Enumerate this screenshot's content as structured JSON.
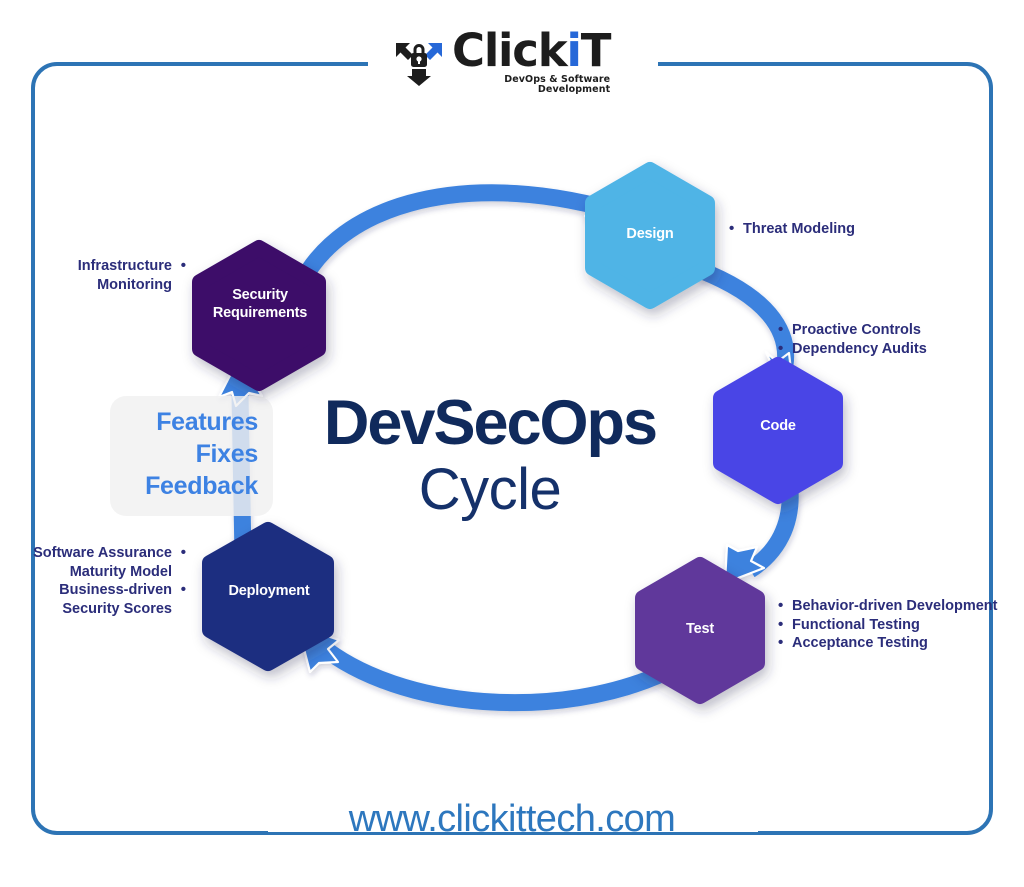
{
  "brand": {
    "logo_word_1": "Click",
    "logo_word_k": "i",
    "logo_word_2": "T",
    "logo_tagline": "DevOps & Software Development",
    "logo_icon": "shield-lock-arrows-icon"
  },
  "title": {
    "main": "DevSecOps",
    "sub": "Cycle"
  },
  "feature_box": {
    "line1": "Features",
    "line2": "Fixes",
    "line3": "Feedback"
  },
  "stages": [
    {
      "id": "security",
      "label": "Security\nRequirements",
      "color": "#3C1069"
    },
    {
      "id": "design",
      "label": "Design",
      "color": "#4FB4E6"
    },
    {
      "id": "code",
      "label": "Code",
      "color": "#4A45E6"
    },
    {
      "id": "test",
      "label": "Test",
      "color": "#60399B"
    },
    {
      "id": "deployment",
      "label": "Deployment",
      "color": "#1E2E80"
    }
  ],
  "stage_labels": {
    "security_line1": "Security",
    "security_line2": "Requirements",
    "design": "Design",
    "code": "Code",
    "test": "Test",
    "deployment": "Deployment"
  },
  "annotations": {
    "infrastructure": [
      "Infrastructure Monitoring"
    ],
    "software": [
      "Software Assurance Maturity Model",
      "Business-driven Security Scores"
    ],
    "threat": [
      "Threat Modeling"
    ],
    "code": [
      "Proactive Controls",
      "Dependency Audits"
    ],
    "test": [
      "Behavior-driven Development",
      "Functional Testing",
      "Acceptance Testing"
    ]
  },
  "footer": {
    "url": "www.clickittech.com"
  },
  "colors": {
    "frame": "#2D74B5",
    "arrow": "#3C82DE",
    "title": "#102A5C",
    "annotation": "#2B2D7A",
    "feature_text": "#3D82E3",
    "feature_box_bg": "#F0F0F0",
    "footer": "#2D77BE"
  }
}
